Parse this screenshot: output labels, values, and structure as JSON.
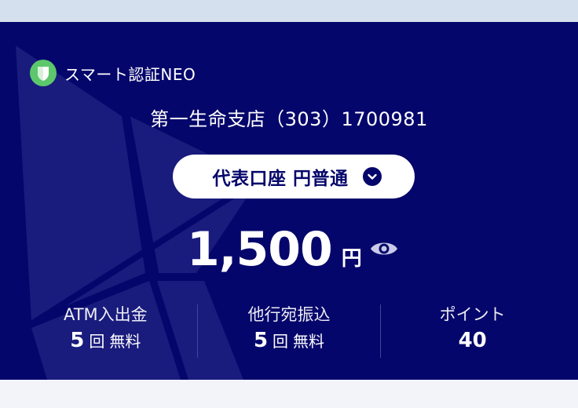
{
  "app": {
    "name": "スマート認証NEO",
    "icon": "shield-icon",
    "accent": "#5cc76b"
  },
  "account": {
    "branch_line": "第一生命支店（303）1700981",
    "selector_label": "代表口座 円普通",
    "balance": "1,500",
    "currency_unit": "円"
  },
  "stats": [
    {
      "label": "ATM入出金",
      "value": "5",
      "unit": "回",
      "note": "無料"
    },
    {
      "label": "他行宛振込",
      "value": "5",
      "unit": "回",
      "note": "無料"
    },
    {
      "label": "ポイント",
      "value": "40",
      "unit": "",
      "note": ""
    }
  ],
  "colors": {
    "card_bg": "#05066b",
    "button_bg": "#ffffff",
    "top_band": "#d5e0ee"
  }
}
